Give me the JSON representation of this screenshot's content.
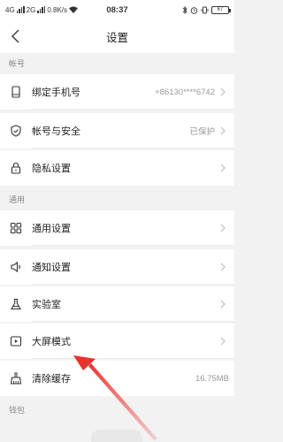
{
  "status_bar": {
    "network_left": "4G",
    "network_right": "2G",
    "speed": "0.8K/s",
    "time": "08:37",
    "battery": "67"
  },
  "nav": {
    "title": "设置"
  },
  "sections": {
    "account": {
      "header": "帐号",
      "items": [
        {
          "label": "绑定手机号",
          "value": "+86130****6742",
          "icon": "phone-icon"
        },
        {
          "label": "帐号与安全",
          "value": "已保护",
          "icon": "shield-icon"
        },
        {
          "label": "隐私设置",
          "value": "",
          "icon": "lock-icon"
        }
      ]
    },
    "general": {
      "header": "通用",
      "items": [
        {
          "label": "通用设置",
          "value": "",
          "icon": "grid-icon"
        },
        {
          "label": "通知设置",
          "value": "",
          "icon": "speaker-icon"
        },
        {
          "label": "实验室",
          "value": "",
          "icon": "flask-icon"
        },
        {
          "label": "大屏模式",
          "value": "",
          "icon": "play-screen-icon"
        },
        {
          "label": "清除缓存",
          "value": "16.75MB",
          "icon": "broom-icon"
        }
      ]
    },
    "wallet": {
      "header": "钱包"
    }
  },
  "colors": {
    "annotation_arrow": "#e8322c",
    "background": "#f2f2f2"
  }
}
